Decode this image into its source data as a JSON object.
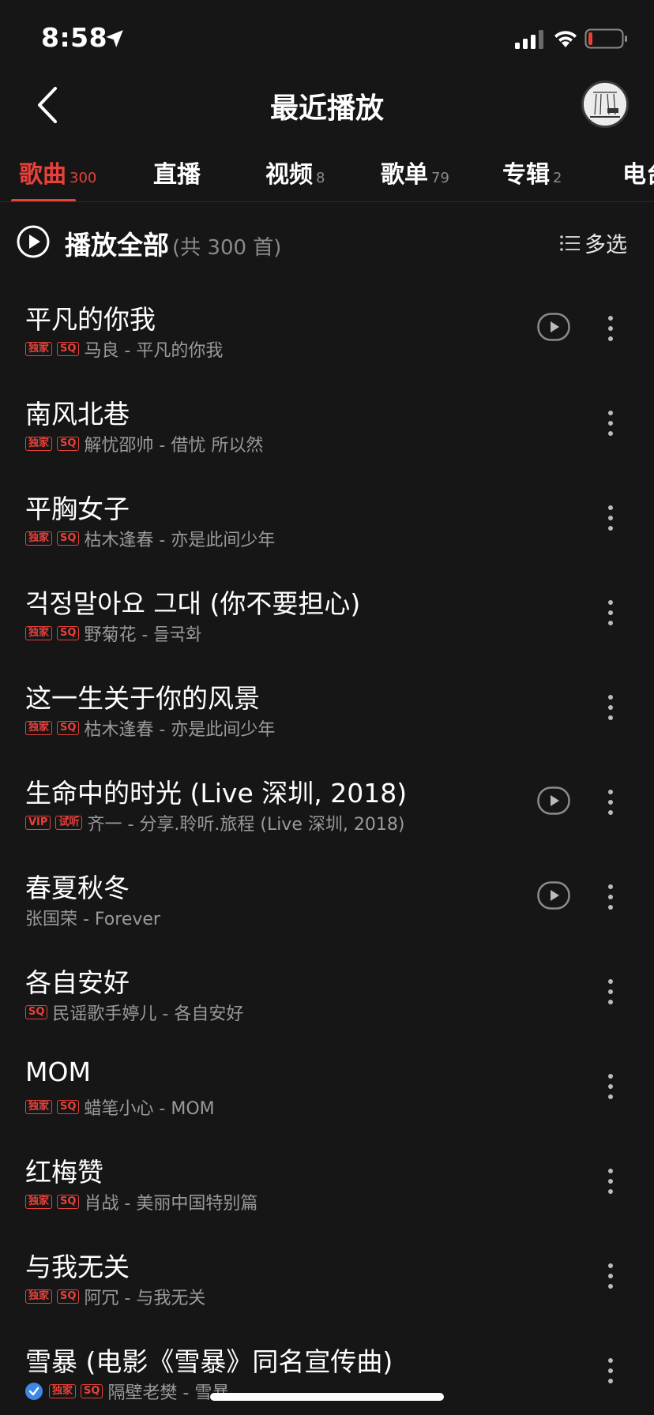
{
  "status_bar": {
    "time": "8:58"
  },
  "nav": {
    "title": "最近播放"
  },
  "tabs": [
    {
      "label": "歌曲",
      "count": "300",
      "active": true
    },
    {
      "label": "直播",
      "count": ""
    },
    {
      "label": "视频",
      "count": "8"
    },
    {
      "label": "歌单",
      "count": "79"
    },
    {
      "label": "专辑",
      "count": "2"
    },
    {
      "label": "电台",
      "count": ""
    }
  ],
  "play_all": {
    "label": "播放全部",
    "count": "(共 300 首)",
    "multi_select": "多选"
  },
  "songs": [
    {
      "title": "平凡的你我",
      "badges": [
        "独家",
        "SQ"
      ],
      "subtitle": "马良 - 平凡的你我",
      "has_mv": true
    },
    {
      "title": "南风北巷",
      "badges": [
        "独家",
        "SQ"
      ],
      "subtitle": "解忧邵帅 - 借忧 所以然",
      "has_mv": false
    },
    {
      "title": "平胸女子",
      "badges": [
        "独家",
        "SQ"
      ],
      "subtitle": "枯木逢春 - 亦是此间少年",
      "has_mv": false
    },
    {
      "title": "걱정말아요 그대 (你不要担心)",
      "badges": [
        "独家",
        "SQ"
      ],
      "subtitle": "野菊花 - 들국화",
      "has_mv": false
    },
    {
      "title": "这一生关于你的风景",
      "badges": [
        "独家",
        "SQ"
      ],
      "subtitle": "枯木逢春 - 亦是此间少年",
      "has_mv": false
    },
    {
      "title": "生命中的时光 (Live 深圳, 2018)",
      "badges": [
        "VIP",
        "试听"
      ],
      "subtitle": "齐一 - 分享.聆听.旅程 (Live 深圳, 2018)",
      "has_mv": true
    },
    {
      "title": "春夏秋冬",
      "badges": [],
      "subtitle": "张国荣 - Forever",
      "has_mv": true
    },
    {
      "title": "各自安好",
      "badges": [
        "SQ"
      ],
      "subtitle": "民谣歌手婷儿 - 各自安好",
      "has_mv": false
    },
    {
      "title": "MOM",
      "badges": [
        "独家",
        "SQ"
      ],
      "subtitle": "蜡笔小心 - MOM",
      "has_mv": false
    },
    {
      "title": "红梅赞",
      "badges": [
        "独家",
        "SQ"
      ],
      "subtitle": "肖战 - 美丽中国特别篇",
      "has_mv": false
    },
    {
      "title": "与我无关",
      "badges": [
        "独家",
        "SQ"
      ],
      "subtitle": "阿冗 - 与我无关",
      "has_mv": false
    },
    {
      "title": "雪暴 (电影《雪暴》同名宣传曲)",
      "badges": [
        "独家",
        "SQ"
      ],
      "subtitle": "隔壁老樊 - 雪暴",
      "has_mv": false,
      "verified": true
    }
  ],
  "colors": {
    "accent": "#e8403a",
    "background": "#161616",
    "secondary_text": "#9a9a9a"
  }
}
